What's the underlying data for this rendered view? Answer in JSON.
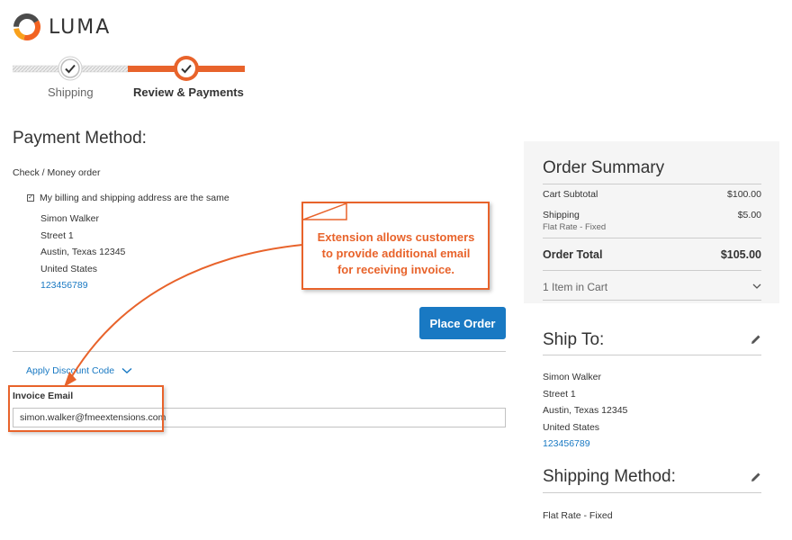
{
  "brand": {
    "name": "LUMA"
  },
  "progress": {
    "steps": [
      {
        "label": "Shipping",
        "state": "complete"
      },
      {
        "label": "Review & Payments",
        "state": "active"
      }
    ]
  },
  "payment": {
    "title": "Payment Method:",
    "method_label": "Check / Money order",
    "same_address_label": "My billing and shipping address are the same",
    "same_address_checked": true,
    "address": {
      "name": "Simon Walker",
      "street": "Street 1",
      "city_line": "Austin, Texas 12345",
      "country": "United States",
      "phone": "123456789"
    },
    "place_order_label": "Place Order",
    "discount_label": "Apply Discount Code",
    "invoice_email_label": "Invoice Email",
    "invoice_email_value": "simon.walker@fmeextensions.com"
  },
  "callout": {
    "lines": [
      "Extension allows customers",
      "to provide additional email",
      "for receiving invoice."
    ]
  },
  "summary": {
    "title": "Order Summary",
    "subtotal_label": "Cart Subtotal",
    "subtotal_value": "$100.00",
    "shipping_label": "Shipping",
    "shipping_value": "$5.00",
    "shipping_method": "Flat Rate - Fixed",
    "total_label": "Order Total",
    "total_value": "$105.00",
    "items_in_cart": "1 Item in Cart"
  },
  "ship_to": {
    "title": "Ship To:",
    "name": "Simon Walker",
    "street": "Street 1",
    "city_line": "Austin, Texas 12345",
    "country": "United States",
    "phone": "123456789"
  },
  "shipping_method": {
    "title": "Shipping Method:",
    "value": "Flat Rate - Fixed"
  },
  "colors": {
    "accent": "#e8632b",
    "primary": "#1979c3",
    "summary_bg": "#f5f5f5"
  }
}
